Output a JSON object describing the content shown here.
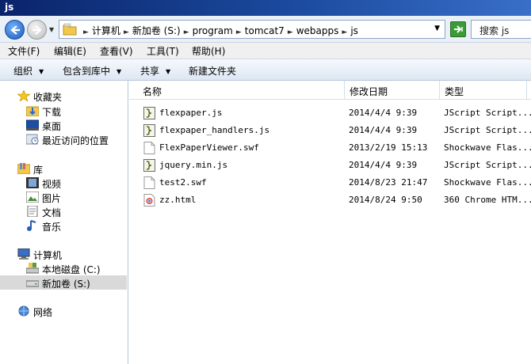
{
  "window": {
    "title": "js"
  },
  "address": {
    "crumbs": [
      "计算机",
      "新加卷 (S:)",
      "program",
      "tomcat7",
      "webapps",
      "js"
    ],
    "search_placeholder": "搜索 js"
  },
  "menu": [
    "文件(F)",
    "编辑(E)",
    "查看(V)",
    "工具(T)",
    "帮助(H)"
  ],
  "toolbar": {
    "organize": "组织",
    "include": "包含到库中",
    "share": "共享",
    "new_folder": "新建文件夹"
  },
  "nav": {
    "favorites": {
      "label": "收藏夹",
      "items": [
        "下载",
        "桌面",
        "最近访问的位置"
      ]
    },
    "libraries": {
      "label": "库",
      "items": [
        "视频",
        "图片",
        "文档",
        "音乐"
      ]
    },
    "computer": {
      "label": "计算机",
      "items": [
        "本地磁盘 (C:)",
        "新加卷 (S:)"
      ]
    },
    "network": {
      "label": "网络"
    }
  },
  "columns": {
    "name": "名称",
    "date": "修改日期",
    "type": "类型"
  },
  "files": [
    {
      "name": "flexpaper.js",
      "date": "2014/4/4 9:39",
      "type": "JScript Script...",
      "icon": "js-file-icon"
    },
    {
      "name": "flexpaper_handlers.js",
      "date": "2014/4/4 9:39",
      "type": "JScript Script...",
      "icon": "js-file-icon"
    },
    {
      "name": "FlexPaperViewer.swf",
      "date": "2013/2/19 15:13",
      "type": "Shockwave Flas...",
      "icon": "swf-file-icon"
    },
    {
      "name": "jquery.min.js",
      "date": "2014/4/4 9:39",
      "type": "JScript Script...",
      "icon": "js-file-icon"
    },
    {
      "name": "test2.swf",
      "date": "2014/8/23 21:47",
      "type": "Shockwave Flas...",
      "icon": "swf-file-icon"
    },
    {
      "name": "zz.html",
      "date": "2014/8/24 9:50",
      "type": "360 Chrome HTM...",
      "icon": "html-file-icon"
    }
  ]
}
